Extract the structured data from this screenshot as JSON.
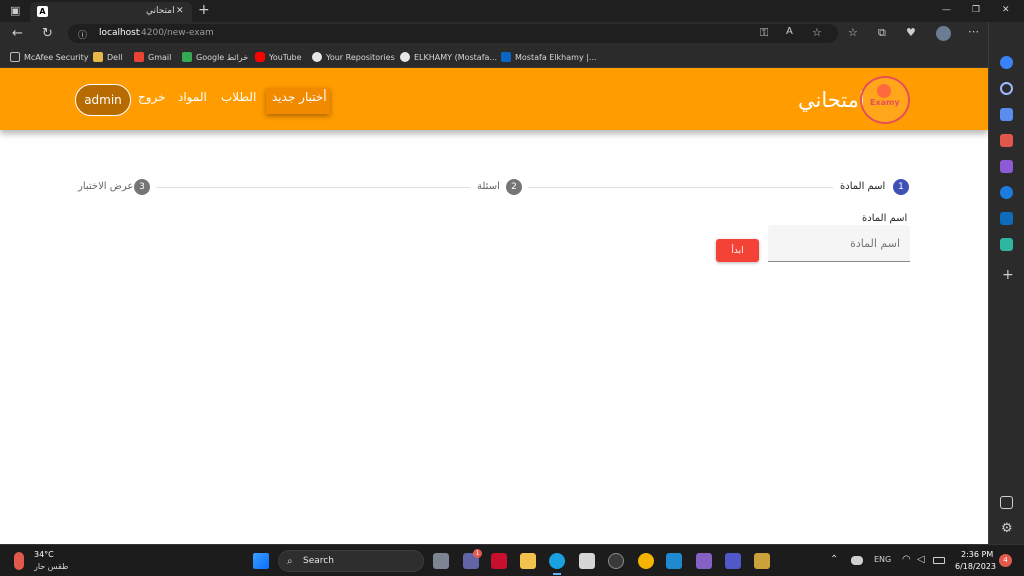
{
  "browser": {
    "tab_title": "امتحاني",
    "tab_close": "✕",
    "new_tab": "+",
    "url_host": "localhost",
    "url_rest": ":4200/new-exam",
    "window_controls": [
      "—",
      "❐",
      "✕"
    ]
  },
  "bookmarks": [
    {
      "label": "McAfee Security",
      "icon": "page-icon"
    },
    {
      "label": "Dell",
      "icon": "folder-icon"
    },
    {
      "label": "Gmail",
      "icon": "gmail-icon"
    },
    {
      "label": "Google خرائط",
      "icon": "maps-icon"
    },
    {
      "label": "YouTube",
      "icon": "youtube-icon"
    },
    {
      "label": "Your Repositories",
      "icon": "github-icon"
    },
    {
      "label": "ELKHAMY (Mostafa...",
      "icon": "github-icon"
    },
    {
      "label": "Mostafa Elkhamy |...",
      "icon": "linkedin-icon"
    }
  ],
  "navbar": {
    "brand": "امتحاني",
    "logo_text": "Examy",
    "links": [
      "أختبار جديد",
      "الطلاب",
      "المواد",
      "خروج"
    ],
    "admin": "admin"
  },
  "stepper": {
    "steps": [
      {
        "number": "1",
        "label": "اسم المادة"
      },
      {
        "number": "2",
        "label": "اسئلة"
      },
      {
        "number": "3",
        "label": "عرض الاختبار"
      }
    ]
  },
  "form": {
    "label": "اسم المادة",
    "placeholder": "اسم المادة",
    "start_button": "ابدأ"
  },
  "taskbar": {
    "weather_temp": "34°C",
    "weather_desc": "طقس حار",
    "search": "Search",
    "lang": "ENG",
    "time": "2:36 PM",
    "date": "6/18/2023",
    "notification_count": "4",
    "teams_badge": "1"
  },
  "colors": {
    "navbar": "#ff9c00",
    "active_link_bg": "#f28a00",
    "admin_bg": "#b86b00",
    "step_active": "#3f51b5",
    "step_inactive": "#757575",
    "start_button": "#f44336"
  }
}
